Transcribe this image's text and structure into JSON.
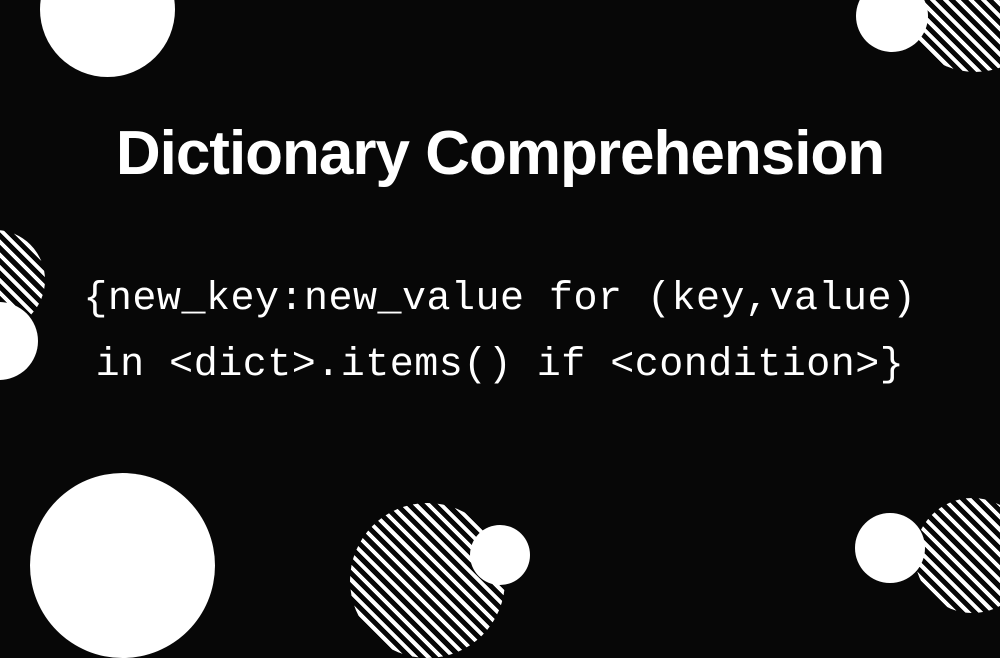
{
  "title": "Dictionary Comprehension",
  "code": {
    "line1": "{new_key:new_value for (key,value)",
    "line2": "in <dict>.items() if <condition>}"
  },
  "colors": {
    "background": "#070707",
    "foreground": "#ffffff"
  }
}
